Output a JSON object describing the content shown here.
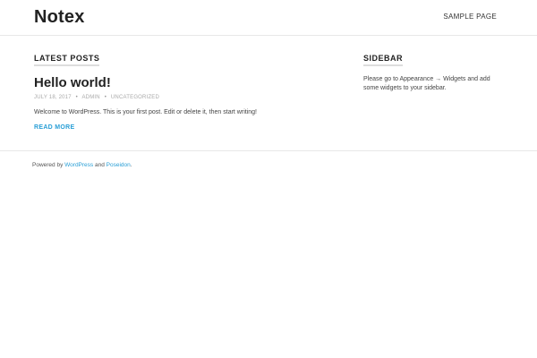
{
  "header": {
    "site_title": "Notex",
    "nav": [
      {
        "label": "SAMPLE PAGE"
      }
    ]
  },
  "main": {
    "section_heading": "LATEST POSTS",
    "post": {
      "title": "Hello world!",
      "meta": {
        "date": "JULY 18, 2017",
        "author": "ADMIN",
        "category": "UNCATEGORIZED",
        "separator": "•"
      },
      "excerpt": "Welcome to WordPress. This is your first post. Edit or delete it, then start writing!",
      "read_more": "READ MORE"
    }
  },
  "sidebar": {
    "heading": "SIDEBAR",
    "text": "Please go to Appearance → Widgets and add some widgets to your sidebar."
  },
  "footer": {
    "prefix": "Powered by ",
    "link1": "WordPress",
    "middle": " and ",
    "link2": "Poseidon",
    "suffix": "."
  },
  "colors": {
    "accent_link": "#2a9fd6",
    "divider": "#e8e8e8"
  }
}
